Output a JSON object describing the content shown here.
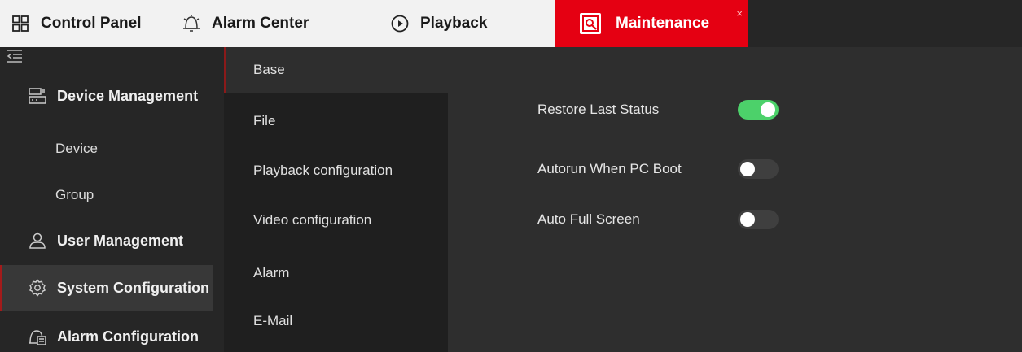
{
  "tabs": [
    {
      "label": "Control Panel",
      "icon": "grid-icon"
    },
    {
      "label": "Alarm Center",
      "icon": "bell-icon"
    },
    {
      "label": "Playback",
      "icon": "play-circle-icon"
    },
    {
      "label": "Maintenance",
      "icon": "maintenance-icon",
      "active": true,
      "close": "×"
    }
  ],
  "sidebar": {
    "items": [
      {
        "label": "Device Management",
        "type": "group",
        "icon": "device-management-icon"
      },
      {
        "label": "Device",
        "type": "sub"
      },
      {
        "label": "Group",
        "type": "sub"
      },
      {
        "label": "User Management",
        "type": "group",
        "icon": "user-icon"
      },
      {
        "label": "System Configuration",
        "type": "group",
        "icon": "gear-icon",
        "active": true
      },
      {
        "label": "Alarm Configuration",
        "type": "group",
        "icon": "alarm-config-icon"
      }
    ]
  },
  "submenu": {
    "items": [
      {
        "label": "Base",
        "active": true
      },
      {
        "label": "File"
      },
      {
        "label": "Playback configuration"
      },
      {
        "label": "Video configuration"
      },
      {
        "label": "Alarm"
      },
      {
        "label": "E-Mail"
      }
    ]
  },
  "settings": [
    {
      "label": "Restore Last Status",
      "enabled": true
    },
    {
      "label": "Autorun When PC Boot",
      "enabled": false
    },
    {
      "label": "Auto Full Screen",
      "enabled": false
    }
  ],
  "colors": {
    "accent_red": "#e50012",
    "toggle_on": "#4cd16a",
    "toggle_off": "#3f3f3f",
    "sidebar_bg": "#262626",
    "submenu_bg": "#1f1f1f",
    "content_bg": "#2e2e2e"
  }
}
